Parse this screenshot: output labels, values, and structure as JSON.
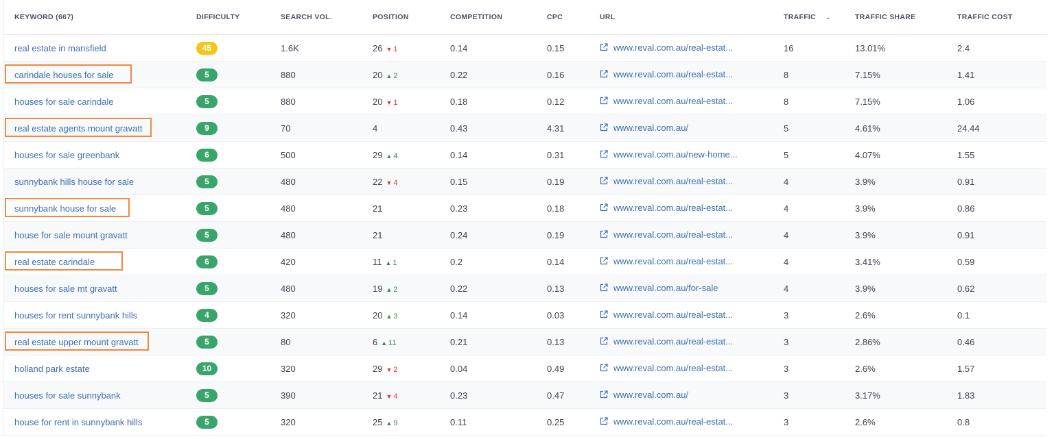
{
  "colors": {
    "link": "#3b6fb0",
    "up": "#2e8b57",
    "down": "#e0393b",
    "highlight": "#f0883e"
  },
  "header": {
    "keyword": "KEYWORD  (667)",
    "difficulty": "DIFFICULTY",
    "search_vol": "SEARCH VOL.",
    "position": "POSITION",
    "competition": "COMPETITION",
    "cpc": "CPC",
    "url": "URL",
    "traffic": "TRAFFIC",
    "traffic_share": "TRAFFIC SHARE",
    "traffic_cost": "TRAFFIC COST"
  },
  "rows": [
    {
      "keyword": "real estate in mansfield",
      "difficulty": "45",
      "badge_color": "#f5c518",
      "search_vol": "1.6K",
      "position": "26",
      "delta": "1",
      "dir": "down",
      "competition": "0.14",
      "cpc": "0.15",
      "url": "www.reval.com.au/real-estat...",
      "traffic": "16",
      "traffic_share": "13.01%",
      "traffic_cost": "2.4",
      "highlight": false
    },
    {
      "keyword": "carindale houses for sale",
      "difficulty": "5",
      "badge_color": "#3aa56a",
      "search_vol": "880",
      "position": "20",
      "delta": "2",
      "dir": "up",
      "competition": "0.22",
      "cpc": "0.16",
      "url": "www.reval.com.au/real-estat...",
      "traffic": "8",
      "traffic_share": "7.15%",
      "traffic_cost": "1.41",
      "highlight": true
    },
    {
      "keyword": "houses for sale carindale",
      "difficulty": "5",
      "badge_color": "#3aa56a",
      "search_vol": "880",
      "position": "20",
      "delta": "1",
      "dir": "down",
      "competition": "0.18",
      "cpc": "0.12",
      "url": "www.reval.com.au/real-estat...",
      "traffic": "8",
      "traffic_share": "7.15%",
      "traffic_cost": "1.06",
      "highlight": false
    },
    {
      "keyword": "real estate agents mount gravatt",
      "difficulty": "9",
      "badge_color": "#3aa56a",
      "search_vol": "70",
      "position": "4",
      "delta": "",
      "dir": "",
      "competition": "0.43",
      "cpc": "4.31",
      "url": "www.reval.com.au/",
      "traffic": "5",
      "traffic_share": "4.61%",
      "traffic_cost": "24.44",
      "highlight": true
    },
    {
      "keyword": "houses for sale greenbank",
      "difficulty": "6",
      "badge_color": "#3aa56a",
      "search_vol": "500",
      "position": "29",
      "delta": "4",
      "dir": "up",
      "competition": "0.14",
      "cpc": "0.31",
      "url": "www.reval.com.au/new-home...",
      "traffic": "5",
      "traffic_share": "4.07%",
      "traffic_cost": "1.55",
      "highlight": false
    },
    {
      "keyword": "sunnybank hills house for sale",
      "difficulty": "5",
      "badge_color": "#3aa56a",
      "search_vol": "480",
      "position": "22",
      "delta": "4",
      "dir": "down",
      "competition": "0.15",
      "cpc": "0.19",
      "url": "www.reval.com.au/real-estat...",
      "traffic": "4",
      "traffic_share": "3.9%",
      "traffic_cost": "0.91",
      "highlight": false
    },
    {
      "keyword": "sunnybank house for sale",
      "difficulty": "5",
      "badge_color": "#3aa56a",
      "search_vol": "480",
      "position": "21",
      "delta": "",
      "dir": "",
      "competition": "0.23",
      "cpc": "0.18",
      "url": "www.reval.com.au/real-estat...",
      "traffic": "4",
      "traffic_share": "3.9%",
      "traffic_cost": "0.86",
      "highlight": true
    },
    {
      "keyword": "house for sale mount gravatt",
      "difficulty": "5",
      "badge_color": "#3aa56a",
      "search_vol": "480",
      "position": "21",
      "delta": "",
      "dir": "",
      "competition": "0.24",
      "cpc": "0.19",
      "url": "www.reval.com.au/real-estat...",
      "traffic": "4",
      "traffic_share": "3.9%",
      "traffic_cost": "0.91",
      "highlight": false
    },
    {
      "keyword": "real estate carindale",
      "difficulty": "6",
      "badge_color": "#3aa56a",
      "search_vol": "420",
      "position": "11",
      "delta": "1",
      "dir": "up",
      "competition": "0.2",
      "cpc": "0.14",
      "url": "www.reval.com.au/real-estat...",
      "traffic": "4",
      "traffic_share": "3.41%",
      "traffic_cost": "0.59",
      "highlight": true
    },
    {
      "keyword": "houses for sale mt gravatt",
      "difficulty": "5",
      "badge_color": "#3aa56a",
      "search_vol": "480",
      "position": "19",
      "delta": "2",
      "dir": "up",
      "competition": "0.22",
      "cpc": "0.13",
      "url": "www.reval.com.au/for-sale",
      "traffic": "4",
      "traffic_share": "3.9%",
      "traffic_cost": "0.62",
      "highlight": false
    },
    {
      "keyword": "houses for rent sunnybank hills",
      "difficulty": "4",
      "badge_color": "#3aa56a",
      "search_vol": "320",
      "position": "20",
      "delta": "3",
      "dir": "up",
      "competition": "0.14",
      "cpc": "0.03",
      "url": "www.reval.com.au/real-estat...",
      "traffic": "3",
      "traffic_share": "2.6%",
      "traffic_cost": "0.1",
      "highlight": false
    },
    {
      "keyword": "real estate upper mount gravatt",
      "difficulty": "5",
      "badge_color": "#3aa56a",
      "search_vol": "80",
      "position": "6",
      "delta": "11",
      "dir": "up",
      "competition": "0.21",
      "cpc": "0.13",
      "url": "www.reval.com.au/real-estat...",
      "traffic": "3",
      "traffic_share": "2.86%",
      "traffic_cost": "0.46",
      "highlight": true
    },
    {
      "keyword": "holland park estate",
      "difficulty": "10",
      "badge_color": "#3aa56a",
      "search_vol": "320",
      "position": "29",
      "delta": "2",
      "dir": "down",
      "competition": "0.04",
      "cpc": "0.49",
      "url": "www.reval.com.au/real-estat...",
      "traffic": "3",
      "traffic_share": "2.6%",
      "traffic_cost": "1.57",
      "highlight": false
    },
    {
      "keyword": "houses for sale sunnybank",
      "difficulty": "5",
      "badge_color": "#3aa56a",
      "search_vol": "390",
      "position": "21",
      "delta": "4",
      "dir": "down",
      "competition": "0.23",
      "cpc": "0.47",
      "url": "www.reval.com.au/",
      "traffic": "3",
      "traffic_share": "3.17%",
      "traffic_cost": "1.83",
      "highlight": false
    },
    {
      "keyword": "house for rent in sunnybank hills",
      "difficulty": "5",
      "badge_color": "#3aa56a",
      "search_vol": "320",
      "position": "25",
      "delta": "9",
      "dir": "up",
      "competition": "0.11",
      "cpc": "0.25",
      "url": "www.reval.com.au/real-estat...",
      "traffic": "3",
      "traffic_share": "2.6%",
      "traffic_cost": "0.8",
      "highlight": false
    }
  ]
}
